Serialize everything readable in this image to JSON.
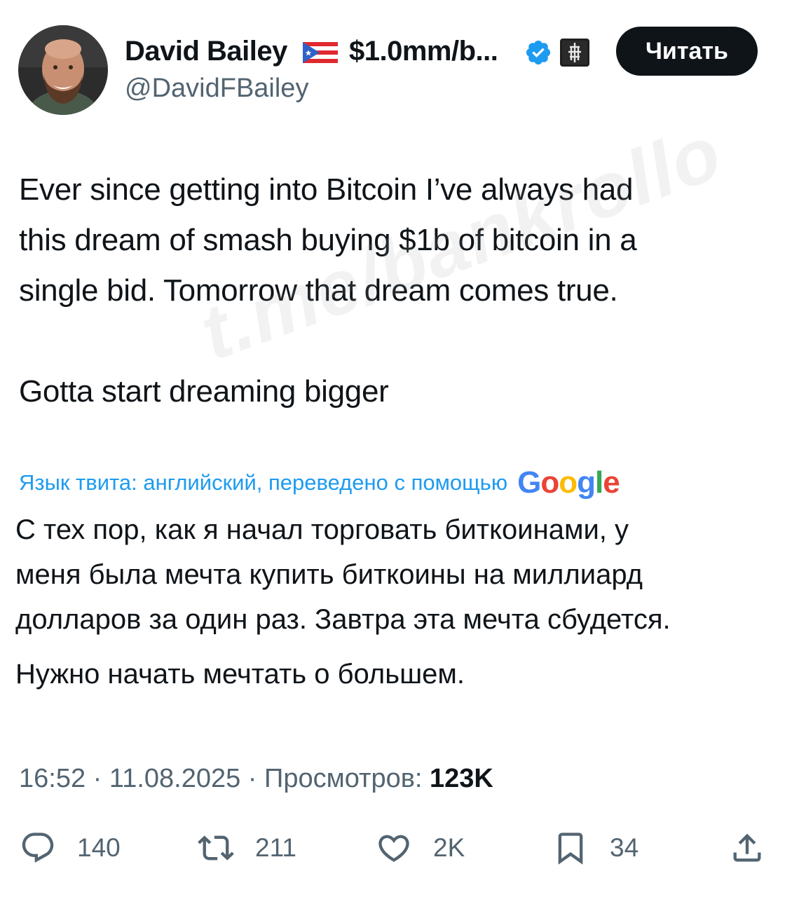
{
  "author": {
    "display_name": "David Bailey",
    "name_suffix": "$1.0mm/b...",
    "handle": "@DavidFBailey",
    "flag_icon": "puerto-rico-flag-icon",
    "verified_icon": "verified-badge-icon",
    "affiliate_icon": "affiliate-badge-icon"
  },
  "follow_button": {
    "label": "Читать"
  },
  "tweet": {
    "lines": [
      "Ever since getting into Bitcoin I’ve always had",
      "this dream of smash buying $1b of bitcoin in a",
      "single bid. Tomorrow that dream comes true.",
      "Gotta start dreaming bigger"
    ]
  },
  "watermark": "t.me/bankrollo",
  "translation": {
    "label": "Язык твита: английский, переведено с помощью",
    "provider": [
      "G",
      "o",
      "o",
      "g",
      "l",
      "e"
    ],
    "lines": [
      "С тех пор, как я начал торговать биткоинами, у",
      "меня была мечта купить биткоины на миллиард",
      "долларов за один раз. Завтра эта мечта сбудется.",
      "Нужно начать мечтать о большем."
    ]
  },
  "meta": {
    "time": "16:52",
    "separator": " · ",
    "date": "11.08.2025",
    "views_label": "Просмотров:",
    "views_count": "123K"
  },
  "actions": {
    "replies": "140",
    "reposts": "211",
    "likes": "2K",
    "bookmarks": "34"
  },
  "colors": {
    "text": "#0f1419",
    "secondary": "#536471",
    "link": "#1d9bf0",
    "verified": "#1d9bf0",
    "button_bg": "#0f1419"
  }
}
